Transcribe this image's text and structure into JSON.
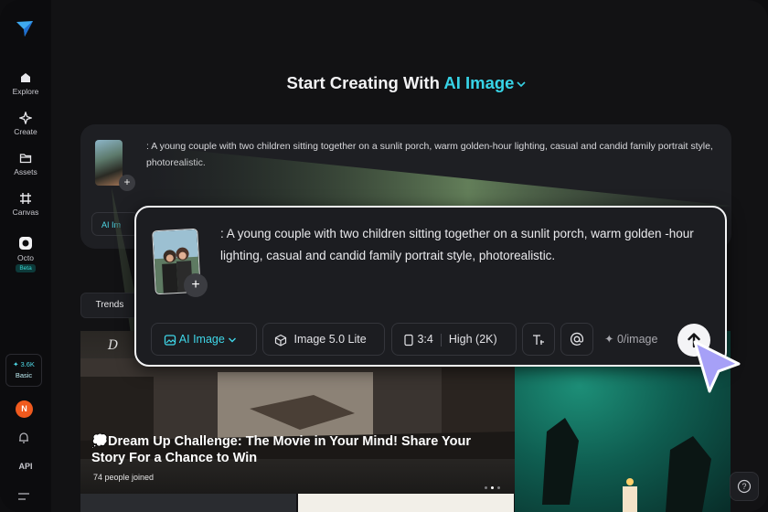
{
  "sidebar": {
    "items": [
      {
        "label": "Explore",
        "icon": "home-icon"
      },
      {
        "label": "Create",
        "icon": "sparkle-icon"
      },
      {
        "label": "Assets",
        "icon": "folder-icon"
      },
      {
        "label": "Canvas",
        "icon": "canvas-icon"
      },
      {
        "label": "Octo",
        "icon": "octo-icon",
        "badge": "Beta"
      }
    ],
    "credits": {
      "amount": "3.6K",
      "plan": "Basic"
    },
    "avatar_letter": "N",
    "api_label": "API"
  },
  "header": {
    "title_prefix": "Start Creating With",
    "title_accent": "AI Image"
  },
  "prompt_card": {
    "text": ": A young couple with two children sitting together on a sunlit porch, warm golden-hour lighting, casual and candid family portrait style, photorealistic.",
    "chip_label": "AI Im"
  },
  "popup": {
    "text": ": A young couple with two children sitting together on a sunlit porch, warm golden -hour lighting, casual and candid family portrait style, photorealistic.",
    "mode_label": "AI Image",
    "model_label": "Image 5.0 Lite",
    "ratio_label": "3:4",
    "quality_label": "High (2K)",
    "cost_label": "0/image"
  },
  "trends_label": "Trends",
  "banner": {
    "brand": "D",
    "title": "💭Dream Up Challenge: The Movie in Your Mind! Share Your Story For a Chance to Win",
    "joined": "74  people joined"
  },
  "colors": {
    "accent": "#37d3e6",
    "credit_accent": "#4fd8e6",
    "avatar": "#f05a1e",
    "cursor": "#a6a0f7"
  }
}
